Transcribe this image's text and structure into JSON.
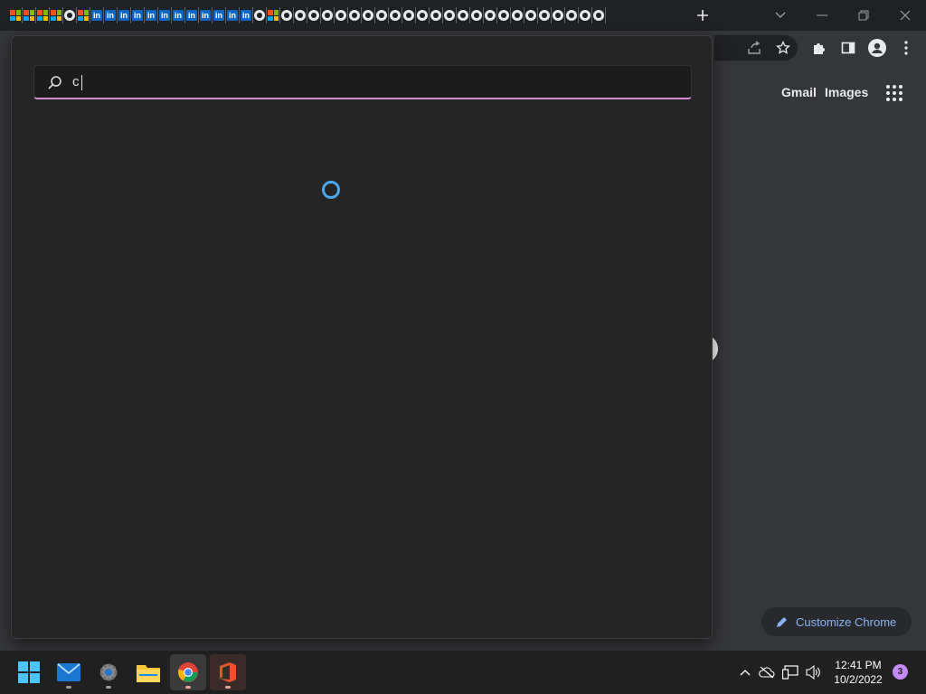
{
  "window": {
    "tab_favicons": [
      "microsoft",
      "microsoft",
      "microsoft",
      "microsoft",
      "github",
      "microsoft",
      "linkedin",
      "linkedin",
      "linkedin",
      "linkedin",
      "linkedin",
      "linkedin",
      "linkedin",
      "linkedin",
      "linkedin",
      "linkedin",
      "linkedin",
      "linkedin",
      "github",
      "microsoft",
      "github",
      "github",
      "github",
      "github",
      "github",
      "github",
      "github",
      "github",
      "github",
      "github",
      "github",
      "github",
      "github",
      "github",
      "github",
      "github",
      "github",
      "github",
      "github",
      "github",
      "github",
      "github",
      "github",
      "github"
    ],
    "new_tab_icon": "plus-icon",
    "controls": [
      "chevron-down-icon",
      "minimize-icon",
      "restore-icon",
      "close-icon"
    ]
  },
  "toolbar": {
    "icons": [
      "share-icon",
      "star-icon",
      "extensions-icon",
      "side-panel-icon",
      "profile-icon",
      "menu-icon"
    ]
  },
  "page": {
    "gmail_label": "Gmail",
    "images_label": "Images",
    "apps_icon": "apps-grid-icon",
    "customize_label": "Customize Chrome",
    "customize_icon": "pencil-icon"
  },
  "search_overlay": {
    "query": "c",
    "search_icon": "search-icon",
    "status": "loading-spinner"
  },
  "taskbar": {
    "apps": [
      {
        "name": "windows-start",
        "icon": "windows-start-icon"
      },
      {
        "name": "mail",
        "icon": "mail-icon"
      },
      {
        "name": "settings",
        "icon": "settings-gear-icon"
      },
      {
        "name": "file-explorer",
        "icon": "folder-icon"
      },
      {
        "name": "chrome",
        "icon": "chrome-icon"
      },
      {
        "name": "office",
        "icon": "office-icon"
      }
    ],
    "time": "12:41 PM",
    "date": "10/2/2022",
    "notification_count": "3",
    "tray_icons": [
      "chevron-up-icon",
      "cloud-offline-icon",
      "network-icon",
      "volume-icon"
    ]
  },
  "colors": {
    "accent_search": "#d48bd7",
    "link_blue": "#8ab4f8",
    "spinner": "#4aa8ee",
    "notification": "#c58af9"
  }
}
